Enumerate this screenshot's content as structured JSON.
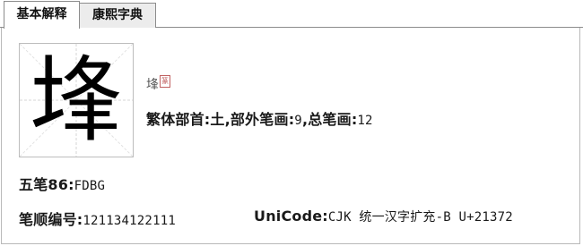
{
  "tabs": [
    {
      "label": "基本解释",
      "active": true
    },
    {
      "label": "康熙字典",
      "active": false
    }
  ],
  "character": {
    "glyph": "埄",
    "small_glyph": "埄",
    "seal_icon": "seal-script-icon"
  },
  "radical": {
    "radical_label": "繁体部首:",
    "radical_value": "土",
    "other_strokes_label": ",部外笔画:",
    "other_strokes_value": "9",
    "total_strokes_label": ",总笔画:",
    "total_strokes_value": "12"
  },
  "wubi": {
    "label": "五笔86:",
    "value": "FDBG"
  },
  "stroke_order": {
    "label": "笔顺编号:",
    "value": "121134122111"
  },
  "unicode": {
    "label": "UniCode:",
    "value": "CJK 统一汉字扩充-B U+21372"
  },
  "colors": {
    "tab_border": "#8c8c8c",
    "grid_line": "#d0d0d0",
    "seal": "#c06060"
  }
}
